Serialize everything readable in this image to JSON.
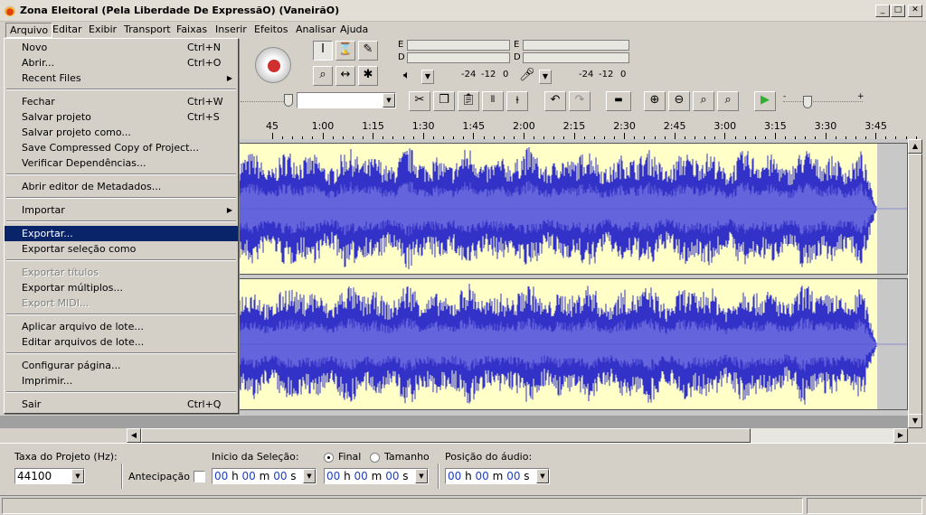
{
  "window": {
    "title": "Zona Eleitoral (Pela Liberdade De ExpressãO) (VaneirãO)",
    "controls": [
      "_",
      "□",
      "✕"
    ]
  },
  "menubar": [
    "Arquivo",
    "Editar",
    "Exibir",
    "Transport",
    "Faixas",
    "Inserir",
    "Efeitos",
    "Analisar",
    "Ajuda"
  ],
  "file_menu": [
    {
      "label": "Novo",
      "shortcut": "Ctrl+N"
    },
    {
      "label": "Abrir...",
      "shortcut": "Ctrl+O"
    },
    {
      "label": "Recent Files",
      "submenu": true
    },
    {
      "sep": true
    },
    {
      "label": "Fechar",
      "shortcut": "Ctrl+W"
    },
    {
      "label": "Salvar projeto",
      "shortcut": "Ctrl+S"
    },
    {
      "label": "Salvar projeto como..."
    },
    {
      "label": "Save Compressed Copy of Project..."
    },
    {
      "label": "Verificar Dependências..."
    },
    {
      "sep": true
    },
    {
      "label": "Abrir editor de Metadados..."
    },
    {
      "sep": true
    },
    {
      "label": "Importar",
      "submenu": true
    },
    {
      "sep": true
    },
    {
      "label": "Exportar...",
      "highlighted": true
    },
    {
      "label": "Exportar seleção como"
    },
    {
      "sep": true
    },
    {
      "label": "Exportar títulos",
      "disabled": true
    },
    {
      "label": "Exportar múltiplos..."
    },
    {
      "label": "Export MIDI...",
      "disabled": true
    },
    {
      "sep": true
    },
    {
      "label": "Aplicar arquivo de lote..."
    },
    {
      "label": "Editar arquivos de lote..."
    },
    {
      "sep": true
    },
    {
      "label": "Configurar página..."
    },
    {
      "label": "Imprimir..."
    },
    {
      "sep": true
    },
    {
      "label": "Sair",
      "shortcut": "Ctrl+Q"
    }
  ],
  "tools": {
    "select": "I",
    "envelope": "⌛",
    "draw": "✎",
    "zoom": "⌕",
    "timeshift": "↔",
    "multi": "✱"
  },
  "meters": {
    "ch_e": "E",
    "ch_d": "D",
    "scale": [
      "-24",
      "-12",
      "0"
    ]
  },
  "timeline": [
    "45",
    "1:00",
    "1:15",
    "1:30",
    "1:45",
    "2:00",
    "2:15",
    "2:30",
    "2:45",
    "3:00",
    "3:15",
    "3:30",
    "3:45"
  ],
  "selection_bar": {
    "rate_label": "Taxa do Projeto (Hz):",
    "rate_value": "44100",
    "antecipacao": "Antecipação",
    "start_label": "Inicio da Seleção:",
    "final_label": "Final",
    "tamanho_label": "Tamanho",
    "pos_label": "Posição do áudio:",
    "time": {
      "h": "00",
      "hs": "h",
      "m": "00",
      "ms": "m",
      "s": "00",
      "ss": "s"
    }
  },
  "colors": {
    "wave": "#3232c8",
    "wave_light": "#6464dc",
    "menu_highlight": "#0a246a",
    "selection": "#ffffc8"
  }
}
